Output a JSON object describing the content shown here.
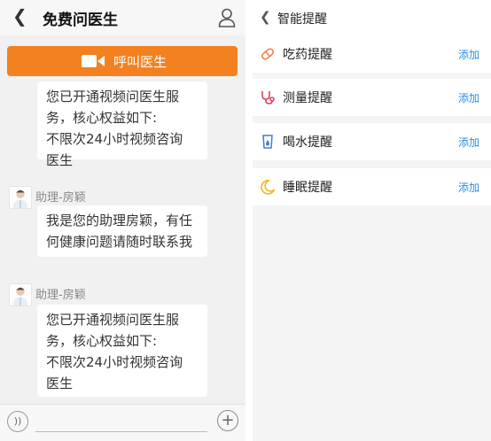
{
  "chat": {
    "title": "免费问医生",
    "call_button_label": "呼叫医生",
    "messages": [
      {
        "lines": [
          "您已开通视频问医生服",
          "务，核心权益如下:",
          "不限次24小时视频咨询",
          "医生"
        ]
      },
      {
        "sender": "助理-房颖",
        "lines": [
          "我是您的助理房颖，有任",
          "何健康问题请随时联系我"
        ]
      },
      {
        "sender": "助理-房颖",
        "lines": [
          "您已开通视频问医生服",
          "务，核心权益如下:",
          "不限次24小时视频咨询",
          "医生"
        ]
      }
    ]
  },
  "reminders": {
    "title": "智能提醒",
    "items": [
      {
        "label": "吃药提醒",
        "action": "添加",
        "icon": "pill-icon"
      },
      {
        "label": "测量提醒",
        "action": "添加",
        "icon": "stethoscope-icon"
      },
      {
        "label": "喝水提醒",
        "action": "添加",
        "icon": "water-cup-icon"
      },
      {
        "label": "睡眠提醒",
        "action": "添加",
        "icon": "moon-icon"
      }
    ]
  },
  "colors": {
    "call_button": "#f3811f",
    "add_link": "#2a8ee6",
    "pill_icon": "#f07f3c",
    "stethoscope_icon": "#d9455f",
    "water_icon": "#3f7fd6",
    "moon_icon": "#f2b51d"
  }
}
